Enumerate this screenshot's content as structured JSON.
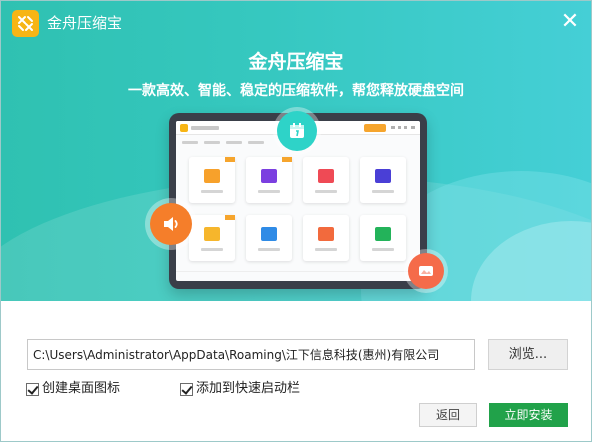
{
  "window": {
    "title": "金舟压缩宝"
  },
  "banner": {
    "headline": "金舟压缩宝",
    "subline": "一款高效、智能、稳定的压缩软件，帮您释放硬盘空间"
  },
  "install": {
    "path_value": "C:\\Users\\Administrator\\AppData\\Roaming\\江下信息科技(惠州)有限公司",
    "browse_label": "浏览...",
    "checkbox_desktop": {
      "label": "创建桌面图标",
      "checked": true
    },
    "checkbox_quicklaunch": {
      "label": "添加到快速启动栏",
      "checked": true
    },
    "back_label": "返回",
    "install_label": "立即安装"
  },
  "colors": {
    "banner_accent": "#36c8c0",
    "install_button": "#21a24a",
    "logo": "#f7b515"
  },
  "icons": [
    "app-logo-icon",
    "close-icon",
    "calendar-icon",
    "speaker-icon",
    "image-icon"
  ]
}
